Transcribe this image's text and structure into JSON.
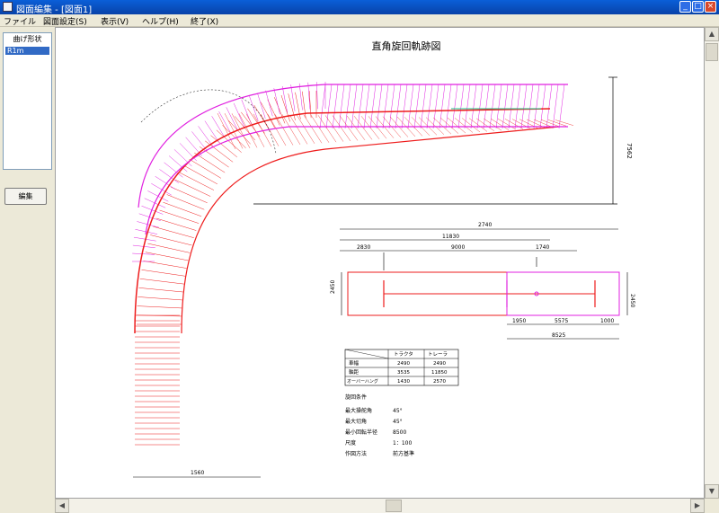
{
  "window": {
    "title": "図面編集 - [図面1]",
    "minimize": "_",
    "maximize": "□",
    "close": "×"
  },
  "menu": [
    "ファイル",
    "図面設定(S)",
    "表示(V)",
    "ヘルプ(H)",
    "終了(X)"
  ],
  "sidebar": {
    "list_header": "曲げ形状",
    "list_items": [
      "R1m"
    ],
    "edit_button": "編集"
  },
  "drawing": {
    "title": "直角旋回軌跡図",
    "dims": {
      "right_vertical": "7562",
      "top_overall": "2740",
      "top_mid": "11830",
      "seg_a": "2830",
      "seg_b": "9000",
      "seg_c": "1740",
      "left_height": "2450",
      "right_height": "2450",
      "bottom_a": "1950",
      "bottom_b": "5575",
      "bottom_c": "1000",
      "bottom_total": "8525",
      "bottom_width": "1560"
    },
    "table": {
      "headers": [
        "",
        "トラクタ",
        "トレーラ"
      ],
      "rows": [
        [
          "車幅",
          "2490",
          "2490"
        ],
        [
          "軸距",
          "3535",
          "11850"
        ],
        [
          "オーバーハング",
          "1430",
          "2570"
        ]
      ]
    },
    "specs_title": "旋回条件",
    "specs": [
      {
        "label": "最大操舵角",
        "value": "45°"
      },
      {
        "label": "最大切角",
        "value": "45°"
      },
      {
        "label": "最小回転半径",
        "value": "8500"
      },
      {
        "label": "尺度",
        "value": "1：100"
      },
      {
        "label": "作図方法",
        "value": "前方基準"
      }
    ]
  },
  "colors": {
    "path_red": "#ee1c1c",
    "path_magenta": "#e020e0",
    "titlebar": "#0a5fd8"
  }
}
